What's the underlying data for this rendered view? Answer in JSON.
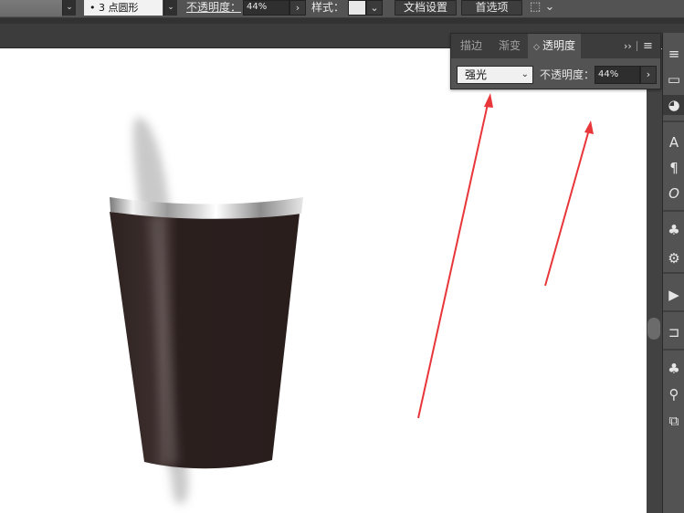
{
  "control_bar": {
    "stroke_dropdown_glyph": "⌄",
    "brush_definition": "•   3 点圆形",
    "brush_dropdown_glyph": "⌄",
    "opacity_label": "不透明度：",
    "opacity_value": "44%",
    "opacity_arrow": "›",
    "style_label": "样式：",
    "style_dropdown_glyph": "⌄",
    "document_setup_label": "文档设置",
    "preferences_label": "首选项",
    "arrange_icon": "⬚",
    "arrange_dropdown_glyph": "⌄"
  },
  "panel": {
    "tabs": [
      {
        "label": "描边",
        "active": false
      },
      {
        "label": "渐变",
        "active": false
      },
      {
        "label": "透明度",
        "active": true
      }
    ],
    "active_tab_swap_glyph": "◇",
    "collapse_glyph": "››",
    "menu_glyph": "≡",
    "blend_mode": "强光",
    "blend_dropdown_glyph": "⌄",
    "opacity_label": "不透明度：",
    "opacity_value": "44%",
    "opacity_arrow": "›"
  },
  "dock": {
    "items": [
      {
        "icon": "menu-icon",
        "glyph": "≡"
      },
      {
        "icon": "gradient-icon",
        "glyph": "▭"
      },
      {
        "icon": "transparency-icon",
        "glyph": "◕"
      },
      {
        "icon": "character-icon",
        "glyph": "A"
      },
      {
        "icon": "paragraph-icon",
        "glyph": "¶"
      },
      {
        "icon": "opentype-icon",
        "glyph": "O"
      },
      {
        "icon": "symbols-icon",
        "glyph": "♣"
      },
      {
        "icon": "settings-icon",
        "glyph": "⚙"
      },
      {
        "icon": "actions-icon",
        "glyph": "▶"
      },
      {
        "icon": "artboards-icon",
        "glyph": "⊐"
      },
      {
        "icon": "symbols-library-icon",
        "glyph": "♣"
      },
      {
        "icon": "puppet-icon",
        "glyph": "⚲"
      },
      {
        "icon": "links-icon",
        "glyph": "⧉"
      }
    ]
  },
  "colors": {
    "cup_body": "#2b1f1e",
    "annotation_arrow": "#e8363a",
    "ui_panel": "#535353",
    "ui_dark": "#3c3c3c"
  }
}
